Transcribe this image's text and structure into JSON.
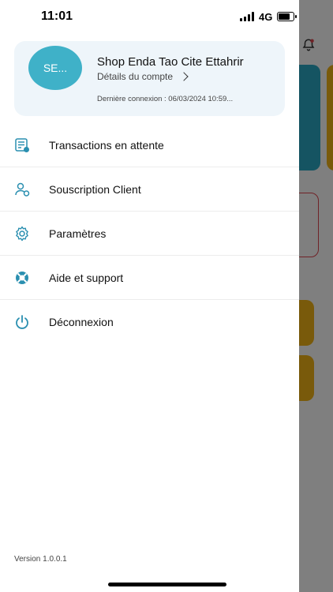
{
  "status_bar": {
    "time": "11:01",
    "network": "4G"
  },
  "account": {
    "avatar_initials": "SE...",
    "name": "Shop Enda Tao  Cite Ettahrir",
    "details_label": "Détails du compte",
    "last_login": "Dernière connexion :  06/03/2024 10:59..."
  },
  "menu": {
    "items": [
      {
        "label": "Transactions en attente",
        "icon": "pending-transactions-icon"
      },
      {
        "label": "Souscription Client",
        "icon": "client-subscription-icon"
      },
      {
        "label": "Paramètres",
        "icon": "gear-icon"
      },
      {
        "label": "Aide et support",
        "icon": "lifebuoy-icon"
      },
      {
        "label": "Déconnexion",
        "icon": "power-icon"
      }
    ]
  },
  "footer": {
    "version": "Version  1.0.0.1"
  },
  "colors": {
    "accent": "#3fb1c8",
    "card_bg": "#eef5fa",
    "bg_teal": "#2aa9c4",
    "bg_yellow": "#f2b416",
    "bg_red": "#e0454f"
  }
}
